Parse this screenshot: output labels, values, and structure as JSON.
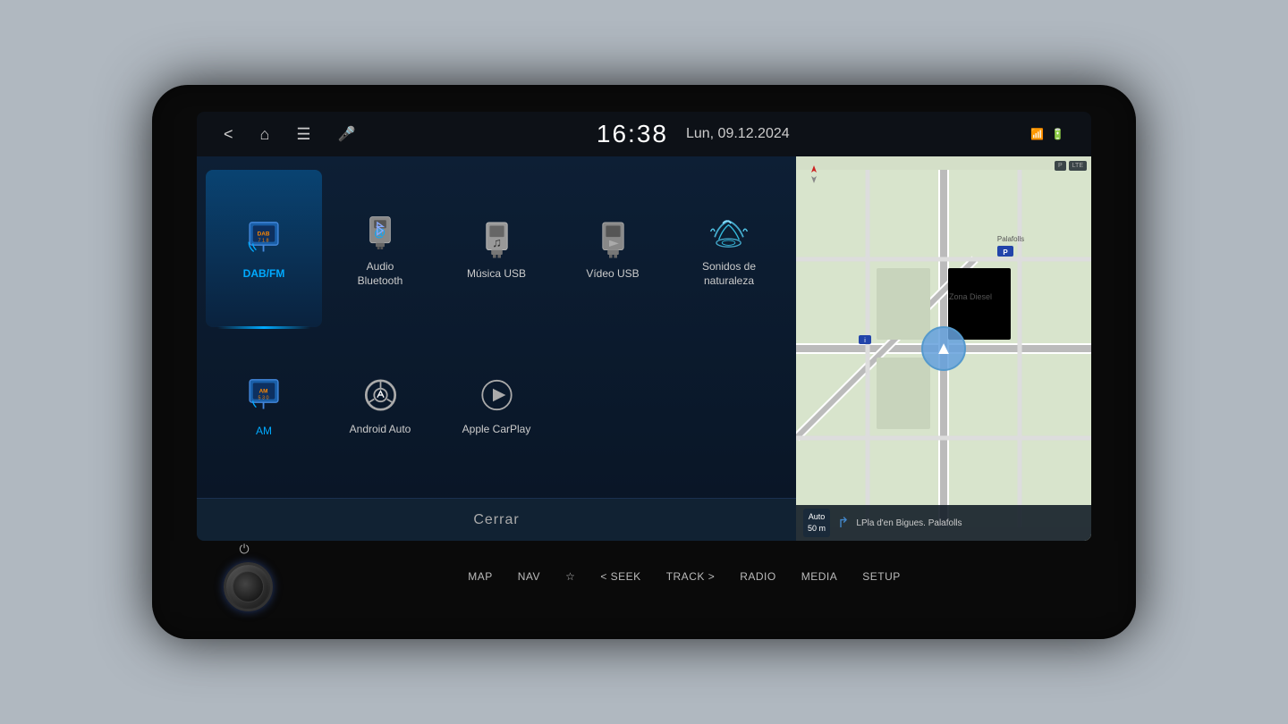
{
  "statusBar": {
    "clock": "16:38",
    "date": "Lun, 09.12.2024",
    "backLabel": "<",
    "homeLabel": "⌂",
    "menuLabel": "≡",
    "micLabel": "🎤"
  },
  "mediaMenu": {
    "items": [
      {
        "id": "dab-fm",
        "label": "DAB/FM",
        "active": true,
        "row": 1
      },
      {
        "id": "audio-bluetooth",
        "label": "Audio\nBluetooth",
        "active": false,
        "row": 1
      },
      {
        "id": "musica-usb",
        "label": "Música USB",
        "active": false,
        "row": 1
      },
      {
        "id": "video-usb",
        "label": "Vídeo USB",
        "active": false,
        "row": 1
      },
      {
        "id": "sonidos-naturaleza",
        "label": "Sonidos de\nnaturaleza",
        "active": false,
        "row": 1
      },
      {
        "id": "am",
        "label": "AM",
        "active": false,
        "row": 2
      },
      {
        "id": "android-auto",
        "label": "Android Auto",
        "active": false,
        "row": 2
      },
      {
        "id": "apple-carplay",
        "label": "Apple CarPlay",
        "active": false,
        "row": 2
      }
    ],
    "closeLabel": "Cerrar"
  },
  "map": {
    "compassLabel": "N",
    "distanceLine1": "Auto",
    "distanceLine2": "50 m",
    "streetLabel": "LPla d'en Bigues. Palafolls"
  },
  "physicalButtons": {
    "buttons": [
      "MAP",
      "NAV",
      "☆",
      "< SEEK",
      "TRACK >",
      "RADIO",
      "MEDIA",
      "SETUP"
    ]
  },
  "colors": {
    "activeBlue": "#00aaff",
    "screenBg": "#0d1f35",
    "textLight": "#ffffff",
    "textMuted": "#aaaaaa"
  }
}
